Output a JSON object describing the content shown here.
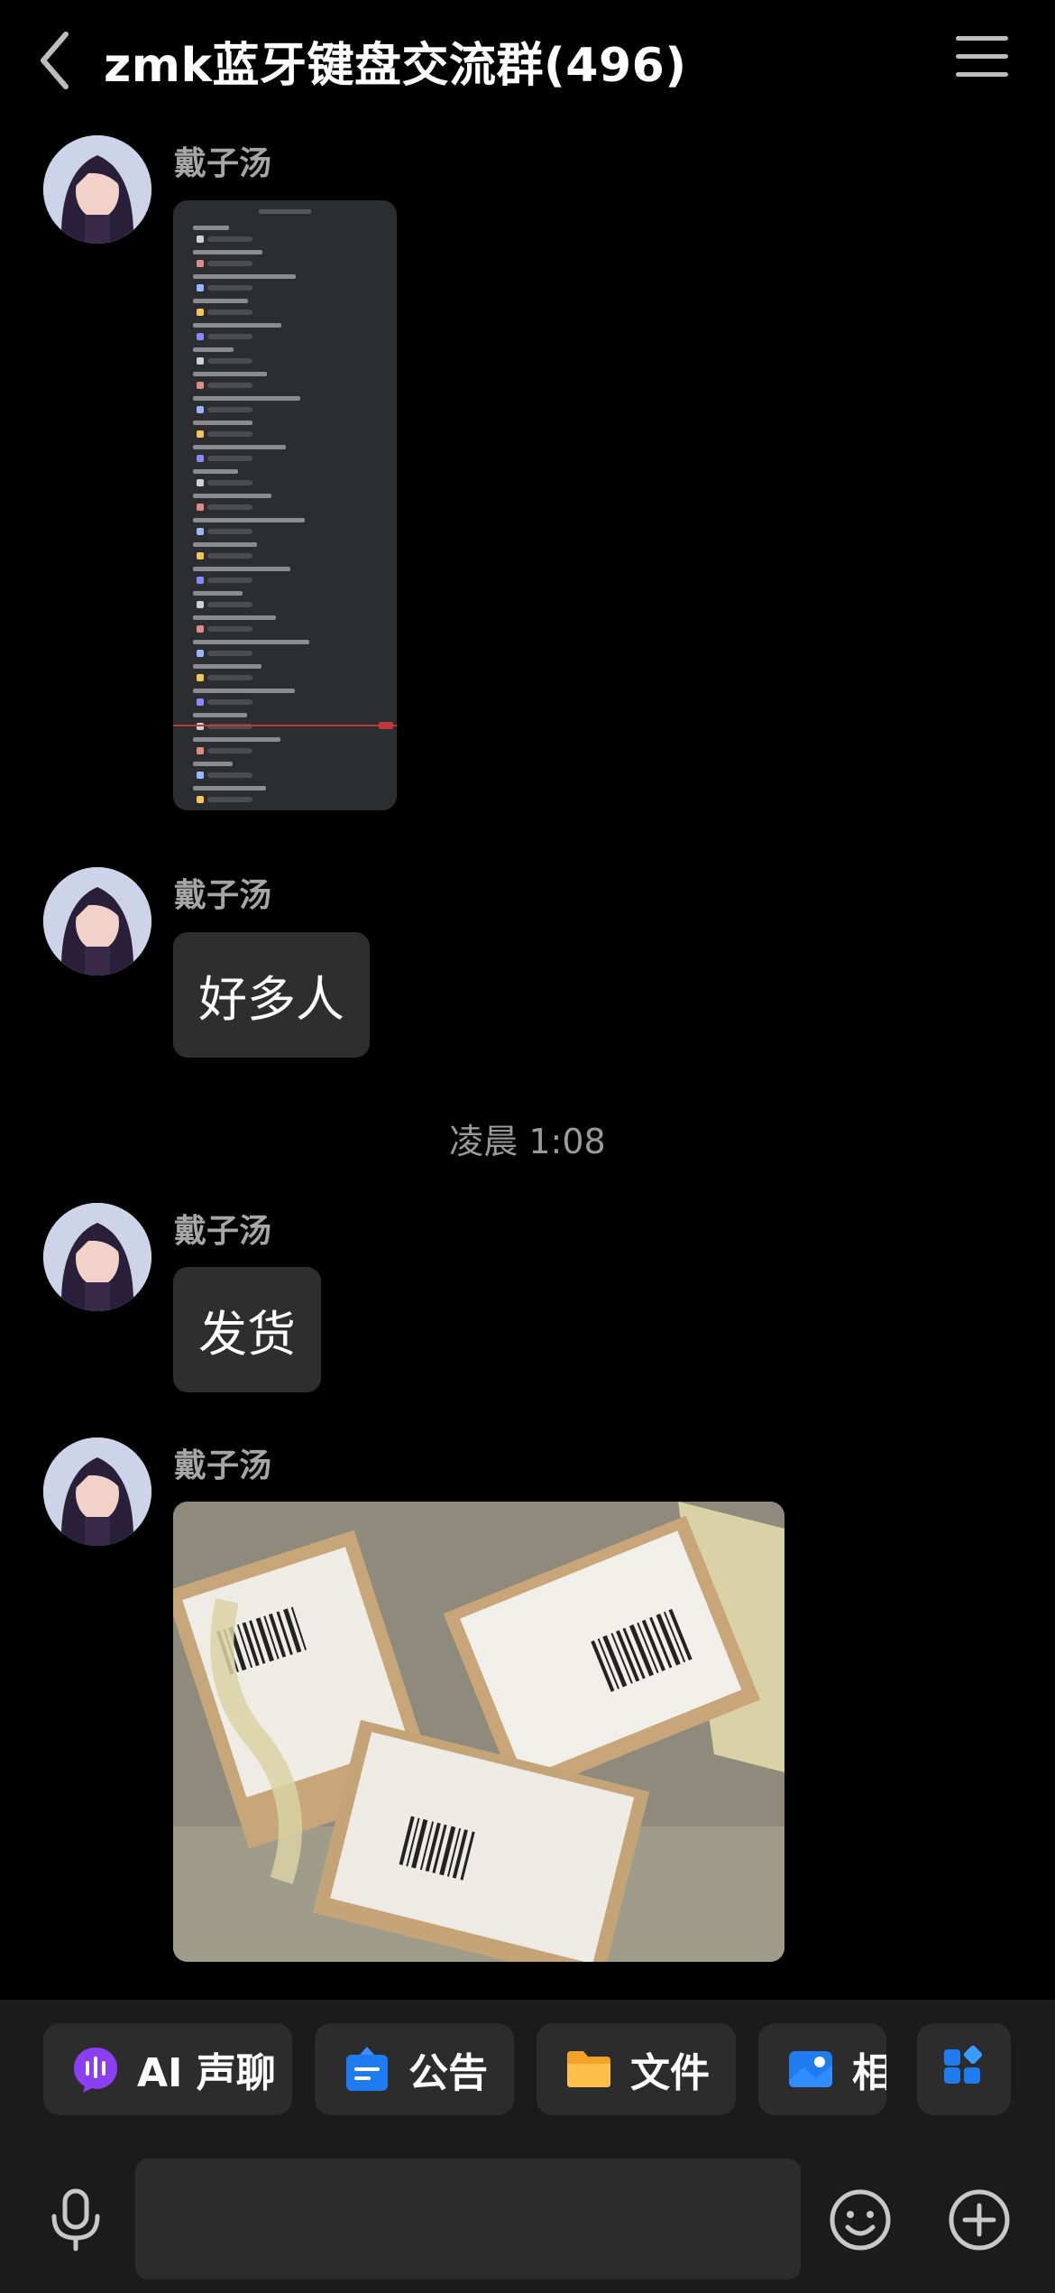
{
  "header": {
    "title": "zmk蓝牙键盘交流群(496)"
  },
  "messages": [
    {
      "sender": "戴子汤",
      "type": "image",
      "image": "chat-list-screenshot"
    },
    {
      "sender": "戴子汤",
      "type": "text",
      "text": "好多人"
    },
    {
      "sender": "戴子汤",
      "type": "text",
      "text": "发货"
    },
    {
      "sender": "戴子汤",
      "type": "image",
      "image": "shipping-packages-photo"
    }
  ],
  "timestamp": "凌晨 1:08",
  "toolbar": {
    "items": [
      {
        "label": "AI 声聊",
        "icon": "ai-voice-chat-icon"
      },
      {
        "label": "公告",
        "icon": "announcement-icon"
      },
      {
        "label": "文件",
        "icon": "folder-icon"
      },
      {
        "label": "相",
        "icon": "album-icon"
      }
    ],
    "more_icon": "apps-grid-icon"
  },
  "composer": {
    "value": "",
    "placeholder": ""
  }
}
